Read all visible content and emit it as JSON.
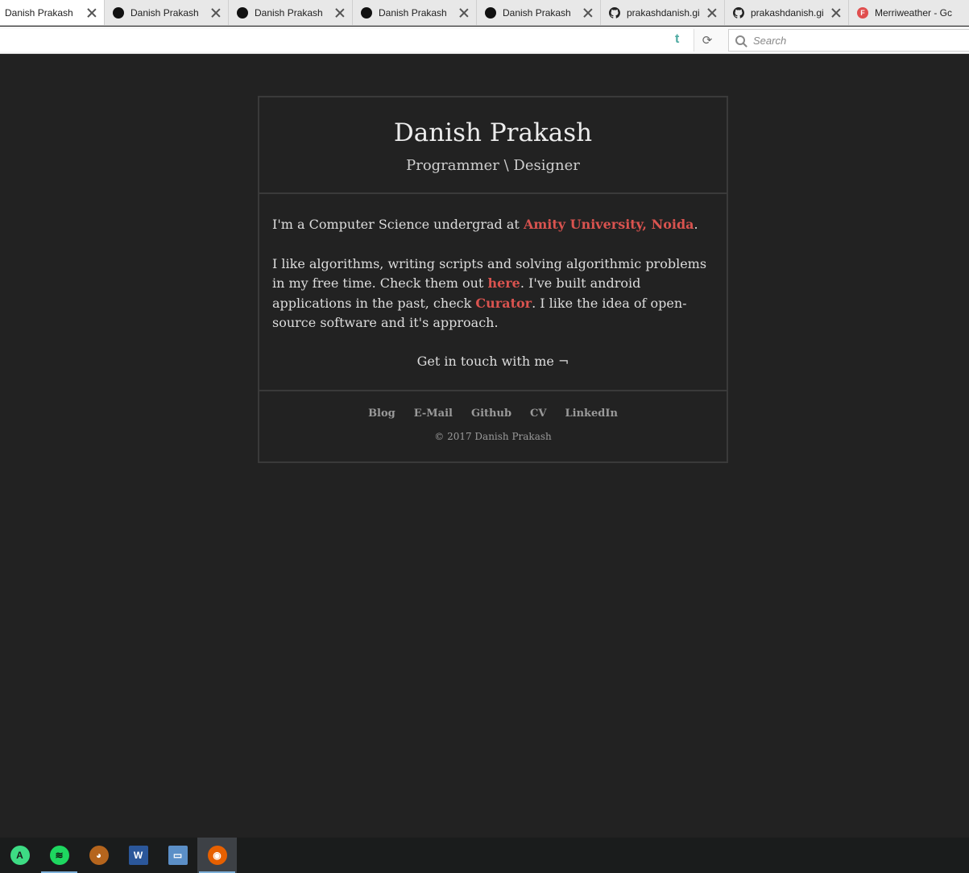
{
  "browser": {
    "tabs": [
      {
        "label": "Danish Prakash",
        "favicon": "none",
        "active": true
      },
      {
        "label": "Danish Prakash",
        "favicon": "black-circle-icon"
      },
      {
        "label": "Danish Prakash",
        "favicon": "black-circle-icon"
      },
      {
        "label": "Danish Prakash",
        "favicon": "black-circle-icon"
      },
      {
        "label": "Danish Prakash",
        "favicon": "black-circle-icon"
      },
      {
        "label": "prakashdanish.gi",
        "favicon": "github-icon"
      },
      {
        "label": "prakashdanish.gi",
        "favicon": "github-icon"
      },
      {
        "label": "Merriweather - Gc",
        "favicon": "google-fonts-icon"
      }
    ],
    "search_placeholder": "Search",
    "tumblr_glyph": "t",
    "reload_glyph": "⟳"
  },
  "page": {
    "title": "Danish Prakash",
    "subtitle": "Programmer \\ Designer",
    "para1": {
      "before": "I'm a Computer Science undergrad at ",
      "link": "Amity University, Noida",
      "after": "."
    },
    "para2": {
      "before": "I like algorithms, writing scripts and solving algorithmic problems in my free time. Check them out ",
      "link1": "here",
      "middle": ". I've built android applications in the past, check ",
      "link2": "Curator",
      "after": ". I like the idea of open-source software and it's approach."
    },
    "contact": "Get in touch with me ¬",
    "footer_links": [
      "Blog",
      "E-Mail",
      "Github",
      "CV",
      "LinkedIn"
    ],
    "copyright": "© 2017 Danish Prakash"
  },
  "colors": {
    "background": "#222222",
    "link": "#d9534f",
    "border": "#3a3a3a"
  },
  "taskbar": {
    "apps": [
      {
        "name": "android-studio-icon",
        "glyph": "A",
        "color": "#3ddc84",
        "running": false
      },
      {
        "name": "spotify-icon",
        "glyph": "≋",
        "color": "#1ed760",
        "running": true
      },
      {
        "name": "bear-app-icon",
        "glyph": "◕",
        "color": "#b5651d",
        "running": false
      },
      {
        "name": "word-icon",
        "glyph": "W",
        "color": "#2b579a",
        "running": false
      },
      {
        "name": "remote-desktop-icon",
        "glyph": "▭",
        "color": "#5b8fc7",
        "running": false
      },
      {
        "name": "firefox-icon",
        "glyph": "◉",
        "color": "#e66000",
        "running": true,
        "focused": true
      }
    ]
  }
}
